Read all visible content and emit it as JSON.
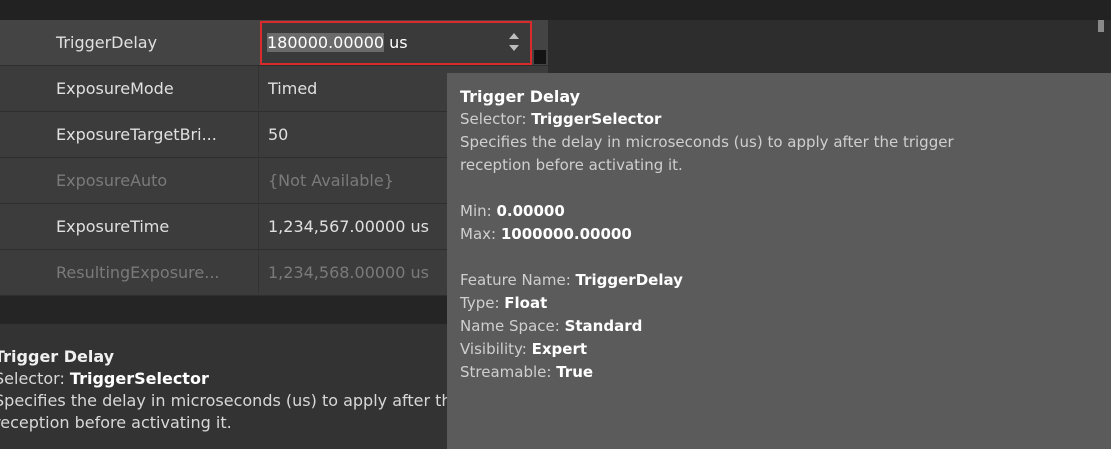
{
  "properties": [
    {
      "name": "TriggerDelay",
      "value_selected": "180000.00000",
      "value_unit": " us"
    },
    {
      "name": "ExposureMode",
      "value": "Timed"
    },
    {
      "name": "ExposureTargetBri...",
      "value": "50"
    },
    {
      "name": "ExposureAuto",
      "value": "{Not Available}"
    },
    {
      "name": "ExposureTime",
      "value": "1,234,567.00000 us"
    },
    {
      "name": "ResultingExposure...",
      "value": "1,234,568.00000 us"
    }
  ],
  "description": {
    "title": "Trigger Delay",
    "selector_label": "Selector: ",
    "selector_value": "TriggerSelector",
    "text_line1": "Specifies the delay in microseconds (us) to apply after the trigger",
    "text_line2": "reception before activating it."
  },
  "tooltip": {
    "title": "Trigger Delay",
    "selector_label": "Selector: ",
    "selector_value": "TriggerSelector",
    "text_line1": "Specifies the delay in microseconds (us) to apply after the trigger",
    "text_line2": "reception before activating it.",
    "min_label": "Min: ",
    "min_value": "0.00000",
    "max_label": "Max: ",
    "max_value": "1000000.00000",
    "feature_name_label": "Feature Name: ",
    "feature_name_value": "TriggerDelay",
    "type_label": "Type: ",
    "type_value": "Float",
    "namespace_label": "Name Space: ",
    "namespace_value": "Standard",
    "visibility_label": "Visibility: ",
    "visibility_value": "Expert",
    "streamable_label": "Streamable: ",
    "streamable_value": "True"
  },
  "colors": {
    "edit_border": "#d92b2b",
    "grid_row_bg": "#3c3c3c",
    "tooltip_bg": "#5b5b5b"
  }
}
